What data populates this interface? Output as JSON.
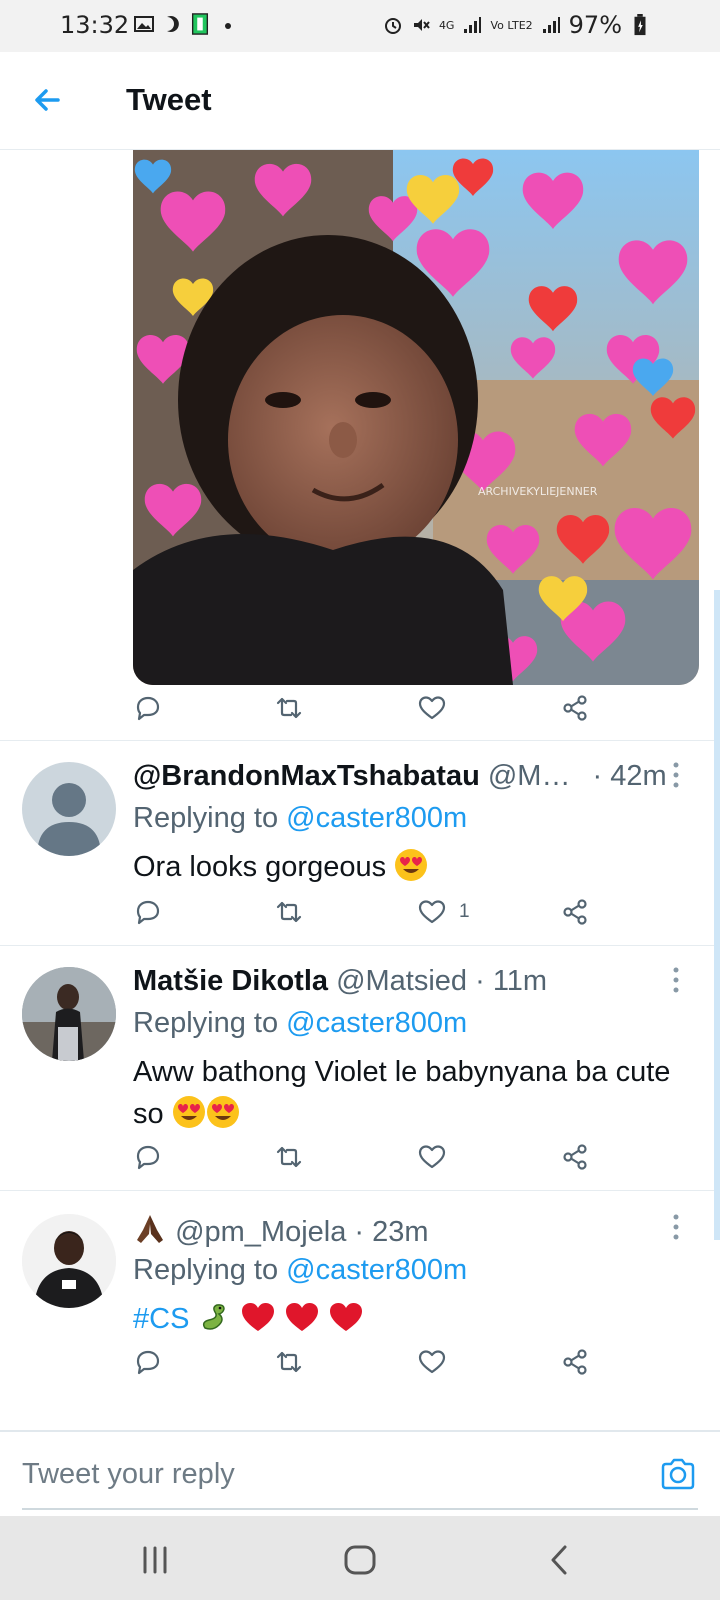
{
  "status_bar": {
    "time": "13:32",
    "battery": "97%",
    "network_labels": [
      "4G",
      "Vo LTE2"
    ]
  },
  "header": {
    "title": "Tweet"
  },
  "media": {
    "watermark": "ARCHIVEKYLIEJENNER"
  },
  "tweet_actions": {
    "like_count": ""
  },
  "replies": [
    {
      "display_name": "@BrandonMaxTshabatau",
      "handle": "@M…",
      "time": "· 42m",
      "replying_label": "Replying to",
      "replying_to": "@caster800m",
      "text": "Ora looks gorgeous",
      "like_count": "1"
    },
    {
      "display_name": "Matšie Dikotla",
      "handle": "@Matsied",
      "time": "· 11m",
      "replying_label": "Replying to",
      "replying_to": "@caster800m",
      "text": "Aww bathong Violet le babynyana ba cute so",
      "like_count": ""
    },
    {
      "display_name": "",
      "handle": "@pm_Mojela",
      "time": "· 23m",
      "replying_label": "Replying to",
      "replying_to": "@caster800m",
      "hashtag": "#CS",
      "like_count": ""
    }
  ],
  "composer": {
    "placeholder": "Tweet your reply"
  },
  "colors": {
    "accent": "#1d9bf0",
    "secondary_text": "#536471",
    "divider": "#e6ecf0"
  },
  "icons": [
    "back-arrow-icon",
    "reply-icon",
    "retweet-icon",
    "like-icon",
    "share-icon",
    "more-vertical-icon",
    "camera-icon",
    "recent-apps-icon",
    "home-icon",
    "back-nav-icon"
  ]
}
